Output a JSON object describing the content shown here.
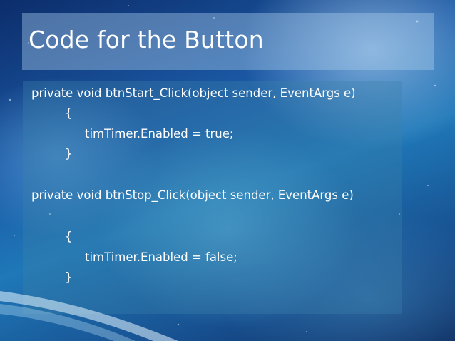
{
  "slide": {
    "title": "Code for the Button",
    "code_lines": [
      "private void btnStart_Click(object sender, EventArgs e)",
      "{",
      "timTimer.Enabled = true;",
      "}",
      "private void btnStop_Click(object sender, EventArgs e)",
      "{",
      "timTimer.Enabled = false;",
      "}"
    ]
  },
  "colors": {
    "text": "#ffffff",
    "background_deep": "#0c2d6b",
    "background_mid": "#1f78b8",
    "panel": "#aacdeb"
  }
}
